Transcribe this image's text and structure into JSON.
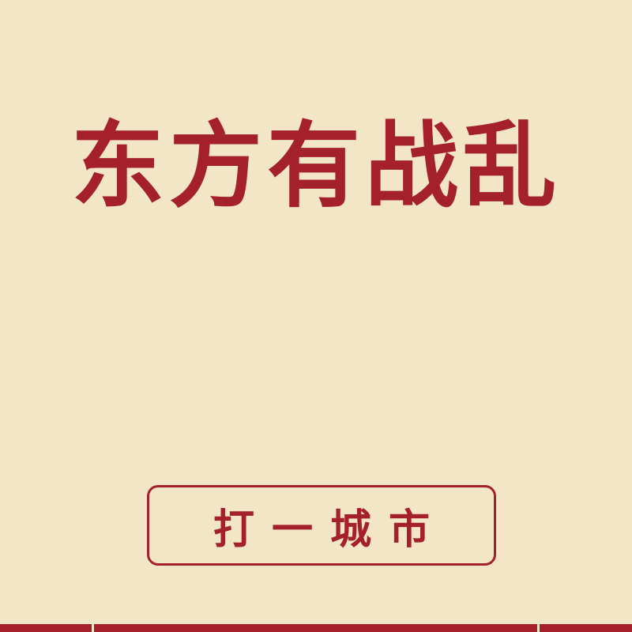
{
  "riddle": {
    "title": "东方有战乱",
    "hint": "打一城市"
  },
  "colors": {
    "background": "#f2e6c7",
    "accent": "#a3202c"
  }
}
